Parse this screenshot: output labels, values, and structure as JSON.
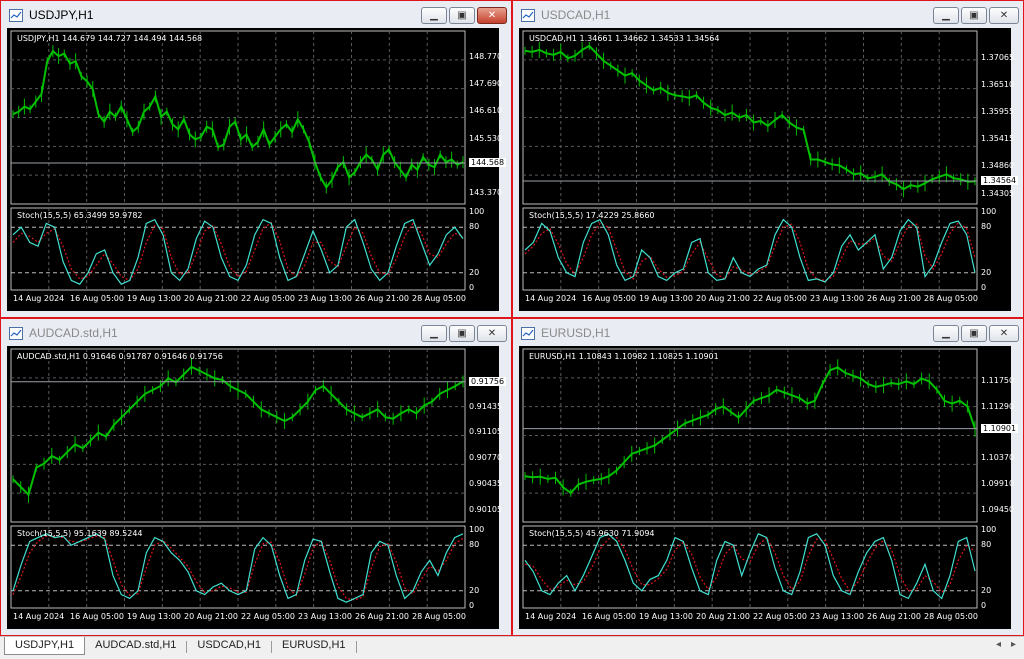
{
  "windows": [
    {
      "id": "w0",
      "title": "USDJPY,H1",
      "active": true,
      "ohlc": "USDJPY,H1  144.679 144.727 144.494 144.568",
      "prices": [
        "148.770",
        "147.690",
        "146.610",
        "145.530",
        "144.568",
        "143.370"
      ],
      "current_price": "144.568",
      "stoch_label": "Stoch(15,5,5) 65.3499 59.9782",
      "stoch_levels": [
        "100",
        "80",
        "20",
        "0"
      ],
      "time_labels": [
        "14 Aug 2024",
        "16 Aug 05:00",
        "19 Aug 13:00",
        "20 Aug 21:00",
        "22 Aug 05:00",
        "23 Aug 13:00",
        "26 Aug 21:00",
        "28 Aug 05:00"
      ],
      "series": [
        146.5,
        146.6,
        146.8,
        146.7,
        147.0,
        147.3,
        148.6,
        149.0,
        148.8,
        148.9,
        148.5,
        148.6,
        148.0,
        147.8,
        147.5,
        146.5,
        146.2,
        146.6,
        146.4,
        146.8,
        146.3,
        145.8,
        146.0,
        146.6,
        146.8,
        147.2,
        146.4,
        146.6,
        146.1,
        145.9,
        146.3,
        145.7,
        145.5,
        145.6,
        146.0,
        145.9,
        145.2,
        145.3,
        146.0,
        146.2,
        145.5,
        145.7,
        145.2,
        145.4,
        145.9,
        145.3,
        145.6,
        145.9,
        146.1,
        145.8,
        146.3,
        145.9,
        145.4,
        144.6,
        144.0,
        143.6,
        143.9,
        144.4,
        144.6,
        144.0,
        144.2,
        144.6,
        144.9,
        144.7,
        144.3,
        144.9,
        145.1,
        144.6,
        144.3,
        144.0,
        144.5,
        144.3,
        144.8,
        144.5,
        144.4,
        144.9,
        144.6,
        144.7,
        144.5,
        144.6
      ],
      "ymin": 143.1,
      "ymax": 149.4,
      "stoch_main": [
        70,
        80,
        60,
        55,
        85,
        80,
        35,
        10,
        5,
        20,
        45,
        50,
        20,
        5,
        10,
        40,
        85,
        90,
        70,
        20,
        10,
        25,
        65,
        88,
        80,
        40,
        15,
        10,
        30,
        70,
        90,
        85,
        40,
        10,
        15,
        45,
        75,
        50,
        20,
        30,
        80,
        90,
        60,
        25,
        10,
        20,
        55,
        85,
        90,
        60,
        30,
        45,
        70,
        80,
        65
      ],
      "stoch_signal": [
        60,
        72,
        68,
        60,
        72,
        78,
        55,
        25,
        12,
        15,
        30,
        45,
        32,
        15,
        10,
        25,
        60,
        82,
        78,
        40,
        18,
        20,
        45,
        75,
        82,
        58,
        28,
        15,
        22,
        50,
        78,
        86,
        62,
        25,
        14,
        30,
        60,
        60,
        35,
        28,
        55,
        80,
        72,
        42,
        20,
        18,
        38,
        68,
        85,
        72,
        45,
        40,
        58,
        72,
        68
      ]
    },
    {
      "id": "w1",
      "title": "USDCAD,H1",
      "active": false,
      "ohlc": "USDCAD,H1  1.34661 1.34662 1.34533 1.34564",
      "prices": [
        "1.37065",
        "1.36510",
        "1.35955",
        "1.35415",
        "1.34860",
        "1.34564",
        "1.34305"
      ],
      "current_price": "1.34564",
      "stoch_label": "Stoch(15,5,5) 17.4229 25.8660",
      "stoch_levels": [
        "100",
        "80",
        "20",
        "0"
      ],
      "time_labels": [
        "14 Aug 2024",
        "16 Aug 05:00",
        "19 Aug 13:00",
        "20 Aug 21:00",
        "22 Aug 05:00",
        "23 Aug 13:00",
        "26 Aug 21:00",
        "28 Aug 05:00"
      ],
      "series": [
        1.372,
        1.3718,
        1.3722,
        1.3715,
        1.3712,
        1.3718,
        1.3705,
        1.371,
        1.3722,
        1.373,
        1.3715,
        1.37,
        1.369,
        1.368,
        1.367,
        1.3675,
        1.366,
        1.365,
        1.364,
        1.3645,
        1.3635,
        1.363,
        1.3628,
        1.3625,
        1.363,
        1.3615,
        1.3605,
        1.36,
        1.359,
        1.3595,
        1.3585,
        1.359,
        1.3575,
        1.3578,
        1.3568,
        1.358,
        1.359,
        1.3575,
        1.3565,
        1.356,
        1.35,
        1.35,
        1.3495,
        1.349,
        1.3488,
        1.348,
        1.347,
        1.3472,
        1.3462,
        1.3465,
        1.347,
        1.3455,
        1.345,
        1.344,
        1.3448,
        1.3445,
        1.3452,
        1.346,
        1.3465,
        1.347,
        1.3462,
        1.346,
        1.3455,
        1.3456
      ],
      "ymin": 1.3418,
      "ymax": 1.374,
      "stoch_main": [
        50,
        60,
        85,
        75,
        40,
        20,
        15,
        60,
        85,
        90,
        70,
        30,
        10,
        15,
        50,
        40,
        15,
        10,
        20,
        25,
        60,
        65,
        20,
        10,
        12,
        40,
        20,
        15,
        25,
        30,
        70,
        90,
        80,
        40,
        10,
        12,
        8,
        20,
        55,
        70,
        50,
        60,
        70,
        25,
        40,
        75,
        90,
        80,
        15,
        30,
        60,
        85,
        88,
        70,
        20
      ],
      "stoch_signal": [
        45,
        55,
        72,
        78,
        58,
        32,
        18,
        40,
        70,
        85,
        80,
        50,
        22,
        12,
        35,
        42,
        25,
        14,
        16,
        22,
        45,
        60,
        38,
        18,
        12,
        28,
        24,
        18,
        22,
        28,
        55,
        80,
        84,
        60,
        25,
        12,
        10,
        15,
        40,
        62,
        58,
        58,
        66,
        42,
        35,
        60,
        82,
        84,
        42,
        25,
        45,
        72,
        86,
        78,
        40
      ]
    },
    {
      "id": "w2",
      "title": "AUDCAD.std,H1",
      "active": false,
      "ohlc": "AUDCAD.std,H1  0.91646 0.91787 0.91646 0.91756",
      "prices": [
        "0.91756",
        "0.91435",
        "0.91105",
        "0.90770",
        "0.90435",
        "0.90105"
      ],
      "current_price": "0.91756",
      "stoch_label": "Stoch(15,5,5) 95.1639 89.5244",
      "stoch_levels": [
        "100",
        "80",
        "20",
        "0"
      ],
      "time_labels": [
        "14 Aug 2024",
        "16 Aug 05:00",
        "19 Aug 13:00",
        "20 Aug 21:00",
        "22 Aug 05:00",
        "23 Aug 13:00",
        "26 Aug 21:00",
        "28 Aug 05:00"
      ],
      "series": [
        0.905,
        0.904,
        0.903,
        0.9065,
        0.907,
        0.908,
        0.9075,
        0.9085,
        0.9095,
        0.909,
        0.91,
        0.911,
        0.9105,
        0.912,
        0.913,
        0.914,
        0.915,
        0.916,
        0.9165,
        0.917,
        0.918,
        0.9175,
        0.9185,
        0.9195,
        0.919,
        0.9185,
        0.918,
        0.9178,
        0.917,
        0.9165,
        0.916,
        0.915,
        0.914,
        0.9135,
        0.913,
        0.9125,
        0.913,
        0.914,
        0.915,
        0.9165,
        0.917,
        0.916,
        0.915,
        0.914,
        0.9135,
        0.913,
        0.9135,
        0.914,
        0.913,
        0.9128,
        0.9135,
        0.914,
        0.9135,
        0.9145,
        0.915,
        0.916,
        0.9165,
        0.917,
        0.9176
      ],
      "ymin": 0.9,
      "ymax": 0.9205,
      "stoch_main": [
        20,
        55,
        85,
        90,
        95,
        90,
        92,
        80,
        85,
        90,
        95,
        88,
        40,
        15,
        10,
        20,
        70,
        90,
        85,
        70,
        60,
        45,
        20,
        15,
        25,
        30,
        20,
        15,
        20,
        75,
        90,
        80,
        40,
        10,
        15,
        60,
        88,
        85,
        45,
        10,
        5,
        10,
        15,
        70,
        85,
        80,
        40,
        10,
        20,
        45,
        60,
        40,
        70,
        90,
        95
      ],
      "stoch_signal": [
        15,
        40,
        70,
        85,
        92,
        92,
        90,
        85,
        84,
        88,
        92,
        90,
        60,
        28,
        14,
        16,
        50,
        80,
        86,
        76,
        64,
        52,
        32,
        18,
        20,
        26,
        24,
        18,
        18,
        55,
        82,
        84,
        58,
        24,
        14,
        42,
        76,
        86,
        60,
        26,
        10,
        8,
        12,
        50,
        78,
        82,
        58,
        24,
        16,
        35,
        52,
        46,
        60,
        82,
        89
      ]
    },
    {
      "id": "w3",
      "title": "EURUSD,H1",
      "active": false,
      "ohlc": "EURUSD,H1  1.10843 1.10982 1.10825 1.10901",
      "prices": [
        "1.11750",
        "1.11290",
        "1.10901",
        "1.10370",
        "1.09910",
        "1.09450"
      ],
      "current_price": "1.10901",
      "stoch_label": "Stoch(15,5,5) 45.9630 71.9094",
      "stoch_levels": [
        "100",
        "80",
        "20",
        "0"
      ],
      "time_labels": [
        "14 Aug 2024",
        "16 Aug 05:00",
        "19 Aug 13:00",
        "20 Aug 21:00",
        "22 Aug 05:00",
        "23 Aug 13:00",
        "26 Aug 21:00",
        "28 Aug 05:00"
      ],
      "series": [
        1.1005,
        1.1003,
        1.1004,
        1.1,
        1.1002,
        1.0985,
        1.0975,
        1.099,
        1.0995,
        1.0998,
        1.1,
        1.1005,
        1.1015,
        1.103,
        1.1045,
        1.105,
        1.1055,
        1.106,
        1.107,
        1.108,
        1.109,
        1.11,
        1.1105,
        1.111,
        1.1115,
        1.1125,
        1.113,
        1.112,
        1.111,
        1.1125,
        1.114,
        1.1145,
        1.115,
        1.116,
        1.1155,
        1.115,
        1.1145,
        1.1135,
        1.114,
        1.117,
        1.1195,
        1.12,
        1.119,
        1.1185,
        1.118,
        1.117,
        1.1165,
        1.1168,
        1.1172,
        1.117,
        1.1175,
        1.117,
        1.118,
        1.1175,
        1.116,
        1.114,
        1.1135,
        1.114,
        1.113,
        1.109
      ],
      "ymin": 1.093,
      "ymax": 1.1215,
      "stoch_main": [
        60,
        45,
        20,
        15,
        30,
        40,
        20,
        40,
        65,
        90,
        95,
        85,
        60,
        30,
        20,
        35,
        40,
        60,
        90,
        85,
        50,
        20,
        15,
        60,
        85,
        80,
        40,
        70,
        95,
        90,
        50,
        20,
        15,
        45,
        90,
        95,
        80,
        40,
        20,
        15,
        45,
        70,
        85,
        90,
        60,
        15,
        10,
        30,
        55,
        20,
        10,
        40,
        85,
        90,
        46
      ],
      "stoch_signal": [
        55,
        52,
        35,
        22,
        25,
        34,
        28,
        32,
        50,
        75,
        88,
        90,
        74,
        48,
        28,
        28,
        36,
        48,
        74,
        84,
        68,
        38,
        22,
        38,
        68,
        80,
        62,
        58,
        80,
        90,
        70,
        40,
        22,
        32,
        66,
        88,
        86,
        62,
        36,
        20,
        32,
        56,
        76,
        86,
        74,
        40,
        20,
        22,
        40,
        32,
        18,
        28,
        60,
        80,
        72
      ]
    }
  ],
  "tabs": [
    "USDJPY,H1",
    "AUDCAD.std,H1",
    "USDCAD,H1",
    "EURUSD,H1"
  ],
  "colors": {
    "candle": "#00c000",
    "grid": "#5a5a5a",
    "stoch_main": "#40e0d0",
    "stoch_signal": "#e0141b",
    "price_line": "#9aa0a8"
  },
  "icons": {
    "minimize": "minimize-icon",
    "restore": "restore-icon",
    "close": "close-icon",
    "left": "scroll-left-icon",
    "right": "scroll-right-icon"
  }
}
